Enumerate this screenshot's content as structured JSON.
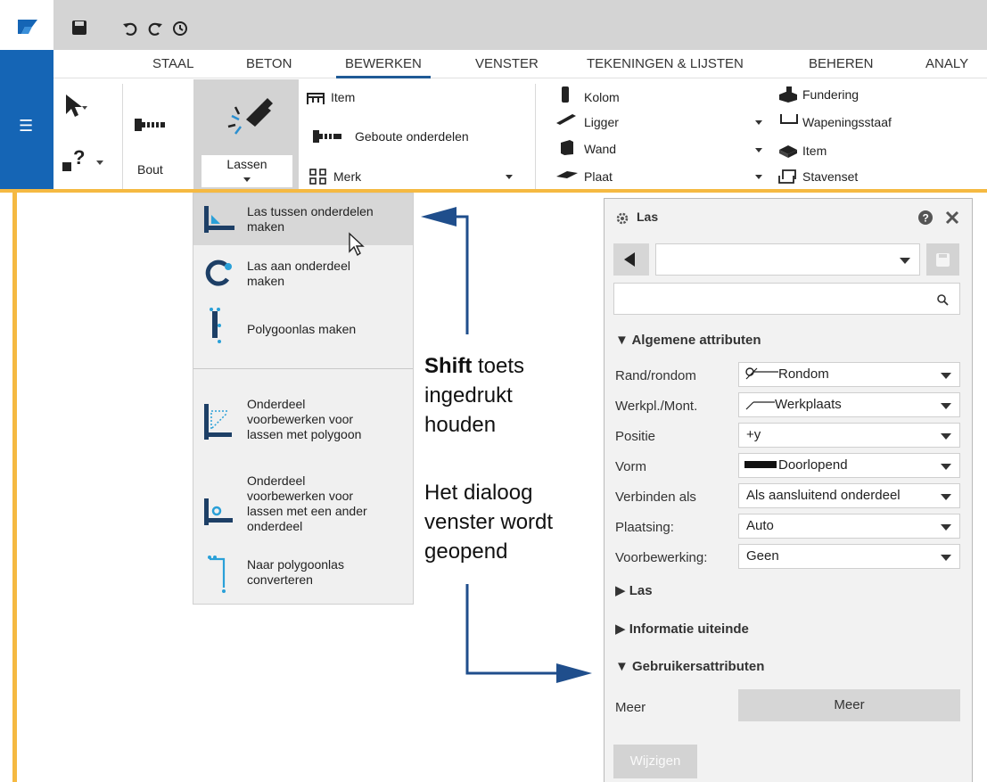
{
  "tabs": [
    "STAAL",
    "BETON",
    "BEWERKEN",
    "VENSTER",
    "TEKENINGEN & LIJSTEN",
    "BEHEREN",
    "ANALY"
  ],
  "ribbon": {
    "bout": "Bout",
    "lassen": "Lassen",
    "item": "Item",
    "geboute": "Geboute onderdelen",
    "merk": "Merk",
    "kolom": "Kolom",
    "ligger": "Ligger",
    "wand": "Wand",
    "plaat": "Plaat",
    "fundering": "Fundering",
    "wapeningsstaaf": "Wapeningsstaaf",
    "item2": "Item",
    "stavenset": "Stavenset"
  },
  "menu": {
    "item1": [
      "Las tussen onderdelen",
      "maken"
    ],
    "item2": [
      "Las aan onderdeel",
      "maken"
    ],
    "item3": [
      "Polygoonlas maken"
    ],
    "item4": [
      "Onderdeel",
      "voorbewerken voor",
      "lassen met polygoon"
    ],
    "item5": [
      "Onderdeel",
      "voorbewerken voor",
      "lassen met een ander",
      "onderdeel"
    ],
    "item6": [
      "Naar polygoonlas",
      "converteren"
    ]
  },
  "annotation": {
    "shift_bold": "Shift",
    "shift_rest": " toets",
    "line2": "ingedrukt",
    "line3": "houden",
    "line4": "Het dialoog",
    "line5": "venster wordt",
    "line6": "geopend"
  },
  "panel": {
    "title": "Las",
    "section_general": "Algemene attributen",
    "rows": [
      {
        "label": "Rand/rondom",
        "value": "Rondom"
      },
      {
        "label": "Werkpl./Mont.",
        "value": "Werkplaats"
      },
      {
        "label": "Positie",
        "value": "+y"
      },
      {
        "label": "Vorm",
        "value": "Doorlopend"
      },
      {
        "label": "Verbinden als",
        "value": "Als aansluitend onderdeel"
      },
      {
        "label": "Plaatsing:",
        "value": "Auto"
      },
      {
        "label": "Voorbewerking:",
        "value": "Geen"
      }
    ],
    "section_las": "Las",
    "section_info": "Informatie uiteinde",
    "section_user": "Gebruikersattributen",
    "meer_label": "Meer",
    "meer_button": "Meer",
    "wijzigen": "Wijzigen"
  },
  "colors": {
    "accent": "#1565b5",
    "tab_underline": "#1f5a96",
    "highlight": "#f5b942",
    "arrow": "#1f4e8c"
  }
}
